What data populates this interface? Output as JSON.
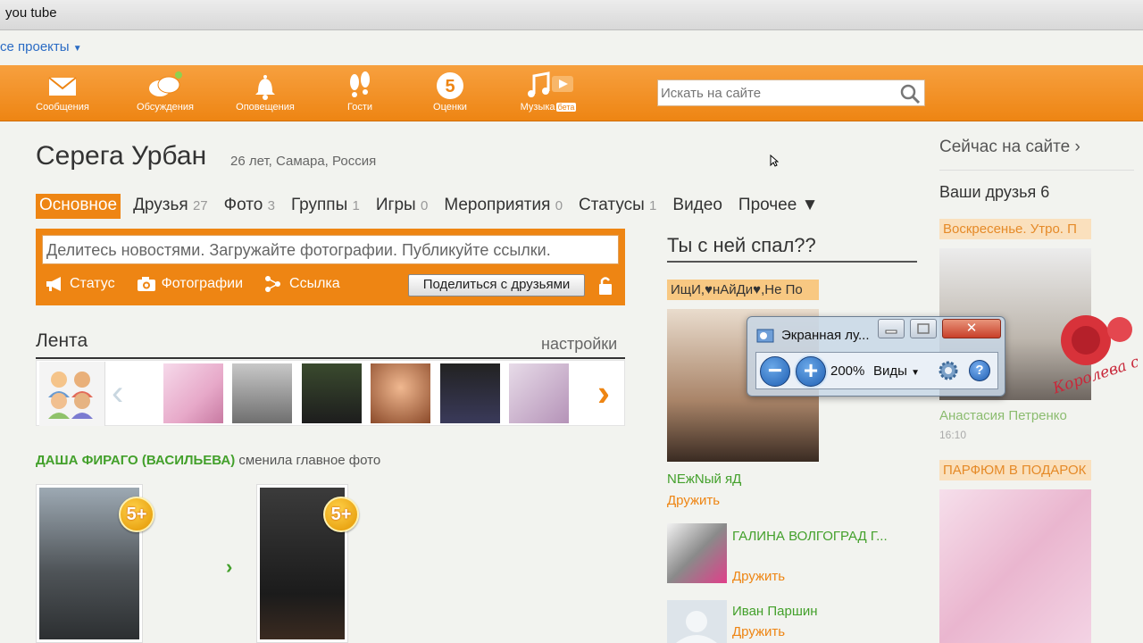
{
  "browser": {
    "address_text": "you tube"
  },
  "projects": {
    "label": "се проекты"
  },
  "toolbar": {
    "items": [
      {
        "label": "Сообщения",
        "icon": "envelope-icon"
      },
      {
        "label": "Обсуждения",
        "icon": "chat-bubbles-icon"
      },
      {
        "label": "Оповещения",
        "icon": "bell-icon"
      },
      {
        "label": "Гости",
        "icon": "footprints-icon"
      },
      {
        "label": "Оценки",
        "icon": "five-rating-icon"
      },
      {
        "label": "Музыка",
        "badge": "бета",
        "icon": "music-note-icon"
      }
    ],
    "search_placeholder": "Искать на сайте"
  },
  "profile": {
    "name": "Серега Урбан",
    "meta": "26 лет, Самара, Россия",
    "tabs": [
      {
        "label": "Основное",
        "count": ""
      },
      {
        "label": "Друзья",
        "count": "27"
      },
      {
        "label": "Фото",
        "count": "3"
      },
      {
        "label": "Группы",
        "count": "1"
      },
      {
        "label": "Игры",
        "count": "0"
      },
      {
        "label": "Мероприятия",
        "count": "0"
      },
      {
        "label": "Статусы",
        "count": "1"
      },
      {
        "label": "Видео",
        "count": ""
      },
      {
        "label": "Прочее ▼",
        "count": ""
      }
    ]
  },
  "share": {
    "placeholder": "Делитесь новостями. Загружайте фотографии. Публикуйте ссылки.",
    "actions": [
      "Статус",
      "Фотографии",
      "Ссылка"
    ],
    "button": "Поделиться с друзьями"
  },
  "feed": {
    "title": "Лента",
    "settings": "настройки",
    "event_who": "ДАША ФИРАГО (ВАСИЛЬЕВА)",
    "event_action": "сменила главное фото",
    "badge": "5+"
  },
  "middle": {
    "title": "Ты с ней спал??",
    "tag": "ИщИ,♥нАйДи♥,Не По",
    "people": [
      {
        "name": "NЕжNый яД",
        "action": "Дружить"
      },
      {
        "name": "ГАЛИНА ВОЛГОГРАД Г...",
        "action": "Дружить"
      },
      {
        "name": "Иван Паршин",
        "action": "Дружить"
      }
    ]
  },
  "right": {
    "now_online": "Сейчас на сайте ›",
    "your_friends": "Ваши друзья 6",
    "tag1": "Воскресенье. Утро. П",
    "photo_caption": "Королева сайта",
    "name": "Анастасия Петренко",
    "time": "16:10",
    "tag2": "ПАРФЮМ В ПОДАРОК"
  },
  "magnifier": {
    "title": "Экранная лу...",
    "zoom": "200%",
    "views": "Виды"
  },
  "colors": {
    "brand_orange": "#ee8513",
    "link_green": "#43a02b",
    "tag_peach": "#f8c882"
  }
}
